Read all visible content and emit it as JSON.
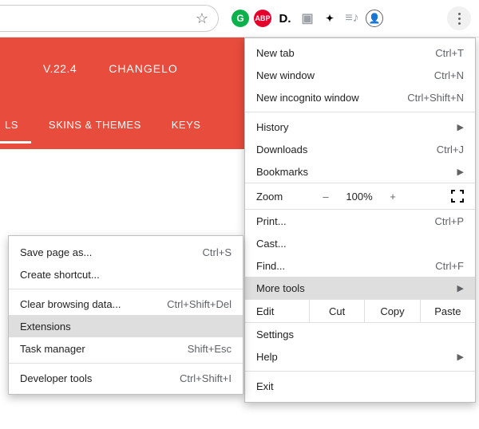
{
  "toolbar": {
    "icons": [
      "grammarly",
      "abp",
      "d",
      "person-box",
      "puzzle",
      "playlist",
      "avatar",
      "kebab"
    ]
  },
  "page": {
    "version": "V.22.4",
    "changelog": "CHANGELO",
    "tabLeft": "LS",
    "tabSkins": "SKINS & THEMES",
    "tabKeys": "KEYS"
  },
  "menu": {
    "new_tab": {
      "label": "New tab",
      "shortcut": "Ctrl+T"
    },
    "new_window": {
      "label": "New window",
      "shortcut": "Ctrl+N"
    },
    "new_incognito": {
      "label": "New incognito window",
      "shortcut": "Ctrl+Shift+N"
    },
    "history": {
      "label": "History"
    },
    "downloads": {
      "label": "Downloads",
      "shortcut": "Ctrl+J"
    },
    "bookmarks": {
      "label": "Bookmarks"
    },
    "zoom": {
      "label": "Zoom",
      "minus": "–",
      "value": "100%",
      "plus": "+"
    },
    "print": {
      "label": "Print...",
      "shortcut": "Ctrl+P"
    },
    "cast": {
      "label": "Cast..."
    },
    "find": {
      "label": "Find...",
      "shortcut": "Ctrl+F"
    },
    "more_tools": {
      "label": "More tools"
    },
    "edit": {
      "label": "Edit",
      "cut": "Cut",
      "copy": "Copy",
      "paste": "Paste"
    },
    "settings": {
      "label": "Settings"
    },
    "help": {
      "label": "Help"
    },
    "exit": {
      "label": "Exit"
    }
  },
  "submenu": {
    "save_page": {
      "label": "Save page as...",
      "shortcut": "Ctrl+S"
    },
    "create_shortcut": {
      "label": "Create shortcut..."
    },
    "clear_data": {
      "label": "Clear browsing data...",
      "shortcut": "Ctrl+Shift+Del"
    },
    "extensions": {
      "label": "Extensions"
    },
    "task_manager": {
      "label": "Task manager",
      "shortcut": "Shift+Esc"
    },
    "developer_tools": {
      "label": "Developer tools",
      "shortcut": "Ctrl+Shift+I"
    }
  }
}
